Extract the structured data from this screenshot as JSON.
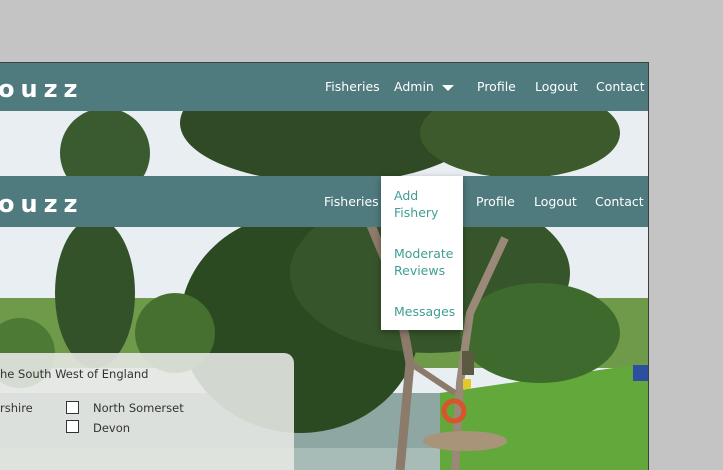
{
  "brand": {
    "name": "ouzz"
  },
  "nav": {
    "fisheries": "Fisheries",
    "admin": "Admin",
    "profile": "Profile",
    "logout": "Logout",
    "contact": "Contact"
  },
  "admin_dropdown": {
    "items": [
      {
        "label": "Add Fishery"
      },
      {
        "label": "Moderate Reviews"
      },
      {
        "label": "Messages"
      }
    ]
  },
  "filter": {
    "title": "he South West of England",
    "options": [
      {
        "label": "rshire",
        "checked": false
      },
      {
        "label": "North Somerset",
        "checked": false
      },
      {
        "label": "Devon",
        "checked": false
      }
    ]
  },
  "colors": {
    "navbar": "#4f7a7e",
    "dropdown_link": "#3f9e93",
    "page_background": "#c4c4c4"
  }
}
